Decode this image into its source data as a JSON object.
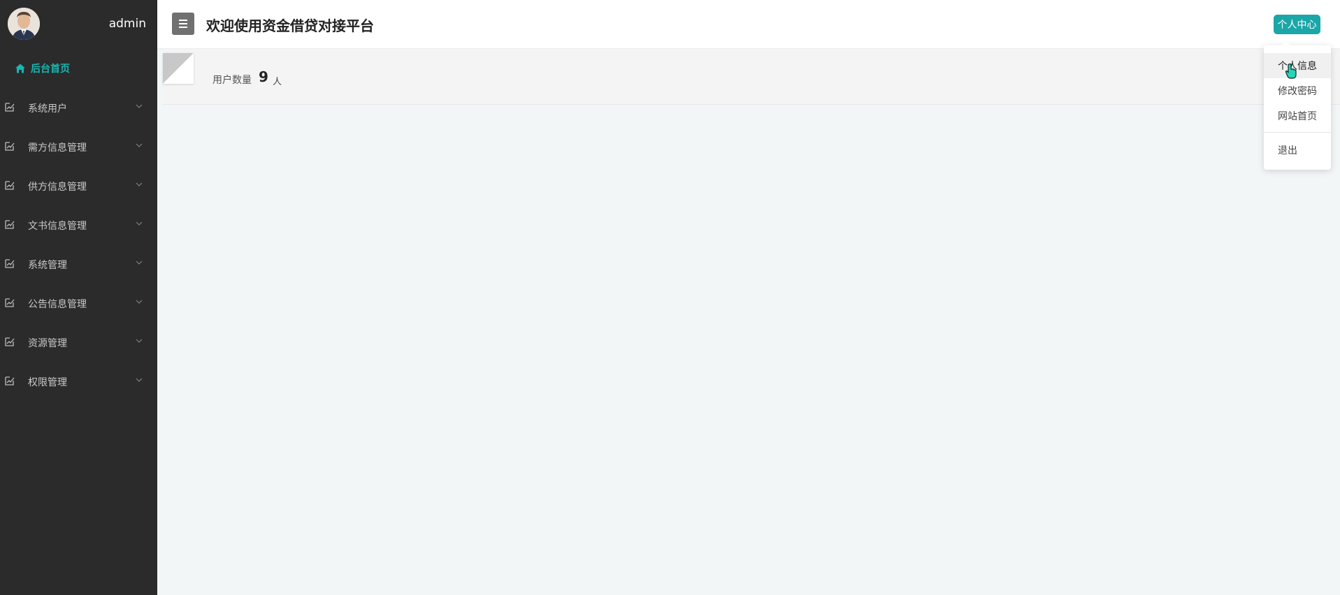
{
  "sidebar": {
    "profile_name": "admin",
    "home_label": "后台首页",
    "items": [
      {
        "label": "系统用户"
      },
      {
        "label": "需方信息管理"
      },
      {
        "label": "供方信息管理"
      },
      {
        "label": "文书信息管理"
      },
      {
        "label": "系统管理"
      },
      {
        "label": "公告信息管理"
      },
      {
        "label": "资源管理"
      },
      {
        "label": "权限管理"
      }
    ]
  },
  "header": {
    "title": "欢迎使用资金借贷对接平台",
    "personal_center_label": "个人中心"
  },
  "stats": {
    "label": "用户数量",
    "value": "9",
    "unit": "人"
  },
  "dropdown": {
    "items": [
      {
        "label": "个人信息"
      },
      {
        "label": "修改密码"
      },
      {
        "label": "网站首页"
      },
      {
        "label": "退出"
      }
    ]
  },
  "colors": {
    "sidebar_bg": "#2b2b2b",
    "accent": "#1ba6a7",
    "home_active": "#1bb5b1"
  }
}
